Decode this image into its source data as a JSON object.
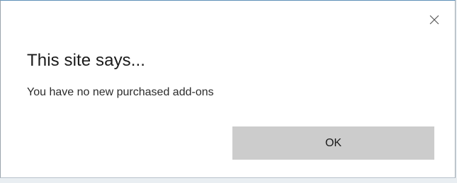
{
  "dialog": {
    "title": "This site says...",
    "message": "You have no new purchased add-ons",
    "ok_label": "OK",
    "close_icon": "close-icon"
  },
  "colors": {
    "button_bg": "#cccccc",
    "dialog_bg": "#ffffff",
    "backdrop": "#e9eef2"
  }
}
